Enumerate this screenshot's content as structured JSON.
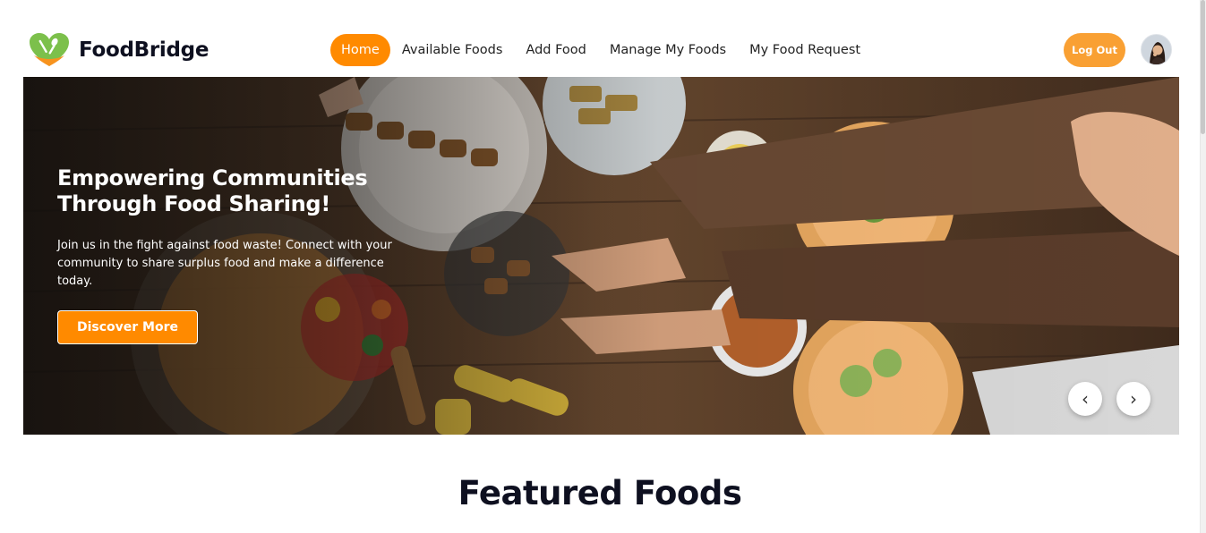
{
  "brand": {
    "name": "FoodBridge",
    "logo_icon": "heart-fork-spoon-logo"
  },
  "nav": {
    "items": [
      {
        "label": "Home",
        "active": true
      },
      {
        "label": "Available Foods",
        "active": false
      },
      {
        "label": "Add Food",
        "active": false
      },
      {
        "label": "Manage My Foods",
        "active": false
      },
      {
        "label": "My Food Request",
        "active": false
      }
    ],
    "logout_label": "Log Out",
    "avatar_icon": "user-avatar"
  },
  "hero": {
    "title": "Empowering Communities Through Food Sharing!",
    "text": "Join us in the fight against food waste! Connect with your community to share surplus food and make a difference today.",
    "button_label": "Discover More",
    "prev_label": "‹",
    "next_label": "›"
  },
  "section": {
    "title": "Featured Foods"
  },
  "colors": {
    "accent": "#ff8a00",
    "logout": "#f9a033",
    "dark_text": "#0e1020"
  }
}
